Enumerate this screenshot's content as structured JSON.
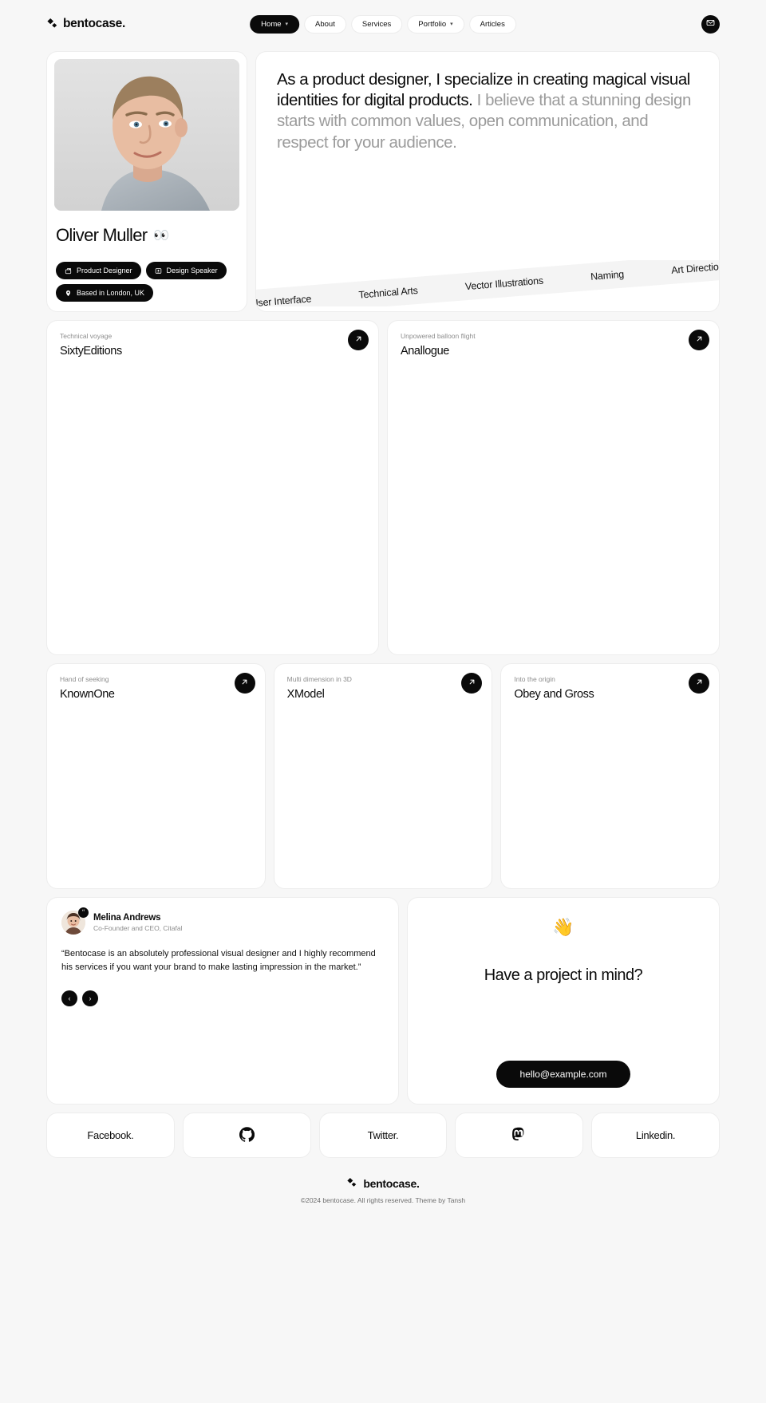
{
  "header": {
    "logo": "bentocase.",
    "logo_icon": "sparkle-diamond-icon",
    "nav": [
      {
        "label": "Home",
        "active": true,
        "caret": "⌄"
      },
      {
        "label": "About",
        "active": false,
        "caret": ""
      },
      {
        "label": "Services",
        "active": false,
        "caret": ""
      },
      {
        "label": "Portfolio",
        "active": false,
        "caret": "⌄"
      },
      {
        "label": "Articles",
        "active": false,
        "caret": ""
      }
    ],
    "mail_button": "mail-icon"
  },
  "profile": {
    "name": "Oliver Muller",
    "eyes_emoji": "👀",
    "photo_alt": "portrait-photo",
    "badges": [
      {
        "label": "Product Designer",
        "icon": "briefcase-icon"
      },
      {
        "label": "Design Speaker",
        "icon": "presenter-icon"
      },
      {
        "label": "Based in London, UK",
        "icon": "location-pin-icon"
      }
    ]
  },
  "intro": {
    "highlight": "As a product designer, I specialize in creating magical visual identities for digital products.",
    "rest": " I believe that a stunning design starts with common values, open communication, and respect for your audience.",
    "skills": [
      "User Interface",
      "Technical Arts",
      "Vector Illustrations",
      "Naming",
      "Art Direction"
    ]
  },
  "projects_big": [
    {
      "kicker": "Technical voyage",
      "title": "SixtyEditions",
      "arrow": "arrow-up-right-icon"
    },
    {
      "kicker": "Unpowered balloon flight",
      "title": "Anallogue",
      "arrow": "arrow-up-right-icon"
    }
  ],
  "projects_small": [
    {
      "kicker": "Hand of seeking",
      "title": "KnownOne",
      "arrow": "arrow-up-right-icon"
    },
    {
      "kicker": "Multi dimension in 3D",
      "title": "XModel",
      "arrow": "arrow-up-right-icon"
    },
    {
      "kicker": "Into the origin",
      "title": "Obey and Gross",
      "arrow": "arrow-up-right-icon"
    }
  ],
  "testimonial": {
    "name": "Melina Andrews",
    "role": "Co-Founder and CEO, Citafal",
    "quote": "“Bentocase is an absolutely professional visual designer and I highly recommend his services if you want your brand to make lasting impression in the market.”",
    "prev_label": "‹",
    "next_label": "›",
    "quote_mark": "“"
  },
  "contact": {
    "wave_emoji": "👋",
    "title": "Have a project in mind?",
    "email": "hello@example.com"
  },
  "social": [
    {
      "label": "Facebook.",
      "icon": ""
    },
    {
      "label": "",
      "icon": "github-icon"
    },
    {
      "label": "Twitter.",
      "icon": ""
    },
    {
      "label": "",
      "icon": "mastodon-icon"
    },
    {
      "label": "Linkedin.",
      "icon": ""
    }
  ],
  "footer": {
    "logo": "bentocase.",
    "copyright": "©2024 bentocase. All rights reserved. Theme by Tansh"
  },
  "colors": {
    "background": "#f7f7f7",
    "card": "#ffffff",
    "border": "#ededed",
    "ink": "#0a0a0a",
    "muted": "#9b9b9b"
  }
}
